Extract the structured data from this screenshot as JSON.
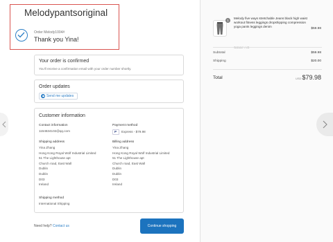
{
  "header": {
    "store_name": "Melodypantsoriginal",
    "order_number": "Order Melody1004#",
    "thanks": "Thank you Yina!"
  },
  "confirmed": {
    "title": "Your order is confirmed",
    "text": "You'll receive a confirmation email with your order number shortly."
  },
  "updates": {
    "title": "Order updates",
    "button_label": "Send me updates"
  },
  "customer": {
    "title": "Customer information",
    "contact_heading": "Contact information",
    "contact_value": "1154634102@qq.com",
    "payment_heading": "Payment method",
    "payment_value": "Express - $79.98",
    "shipping_heading": "Shipping address",
    "shipping_lines": [
      "Yina Zhang",
      "Hong Kong Royal Wolf Industrial Limited",
      "51 The Lighthouse apt",
      "Church road, East Wall",
      "Dublin",
      "Dublin",
      "D03",
      "Ireland"
    ],
    "billing_heading": "Billing address",
    "billing_lines": [
      "Yina Zhang",
      "Hong Kong Royal Wolf Industrial Limited",
      "51 The Lighthouse apt",
      "Church road, East Wall",
      "Dublin",
      "Dublin",
      "D03",
      "Ireland"
    ],
    "method_heading": "Shipping method",
    "method_value": "International Shipping"
  },
  "footer": {
    "help_text": "Need help?",
    "contact_link": "Contact us",
    "continue_label": "Continue shopping"
  },
  "summary": {
    "quantity": "1",
    "product_title": "Melody five ways stretchable Jeans black high waist workout fitness leggings dropshipping compression yoga pants leggings denim",
    "product_variant": "SKINNY / XS",
    "product_price": "$59.98",
    "subtotal_label": "Subtotal",
    "subtotal_value": "$59.98",
    "shipping_label": "Shipping",
    "shipping_value": "$20.00",
    "total_label": "Total",
    "currency": "USD",
    "total_value": "$79.98"
  },
  "icons": {
    "check": "check-circle-icon",
    "message": "message-icon",
    "paypal": "paypal-icon",
    "prev": "chevron-left-icon",
    "next": "chevron-right-icon"
  },
  "colors": {
    "accent": "#1c73be",
    "highlight_border": "#d9534f"
  }
}
